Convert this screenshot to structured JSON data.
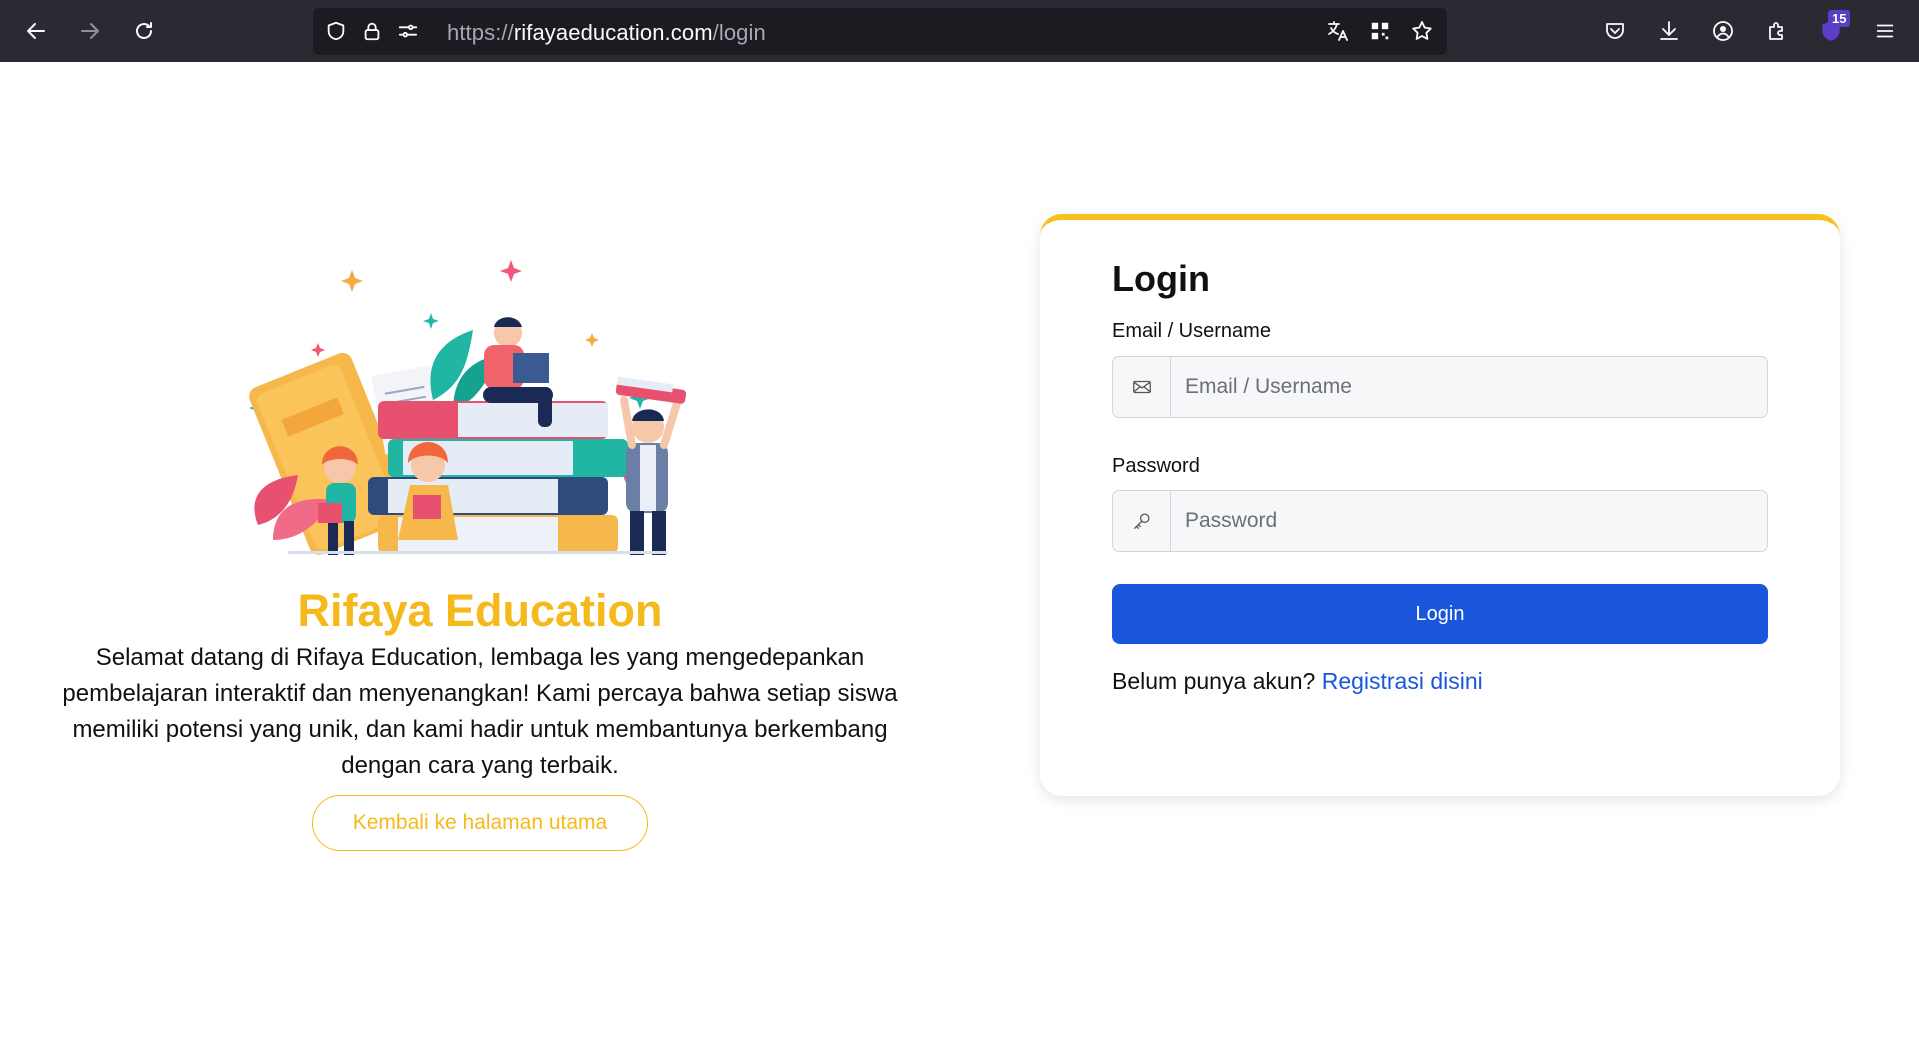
{
  "browser": {
    "url_scheme": "https://",
    "url_host": "rifayaeducation.com",
    "url_path": "/login",
    "extension_badge": "15"
  },
  "hero": {
    "title": "Rifaya Education",
    "description": "Selamat datang di Rifaya Education, lembaga les yang mengedepankan pembelajaran interaktif dan menyenangkan! Kami percaya bahwa setiap siswa memiliki potensi yang unik, dan kami hadir untuk membantunya berkembang dengan cara yang terbaik.",
    "back_button": "Kembali ke halaman utama"
  },
  "login": {
    "title": "Login",
    "email_label": "Email / Username",
    "email_placeholder": "Email / Username",
    "password_label": "Password",
    "password_placeholder": "Password",
    "submit": "Login",
    "register_prompt": "Belum punya akun?",
    "register_link": "Registrasi disini"
  },
  "colors": {
    "brand_yellow": "#f5b91b",
    "primary_blue": "#1a56db",
    "chrome_bg": "#2b2a33"
  }
}
